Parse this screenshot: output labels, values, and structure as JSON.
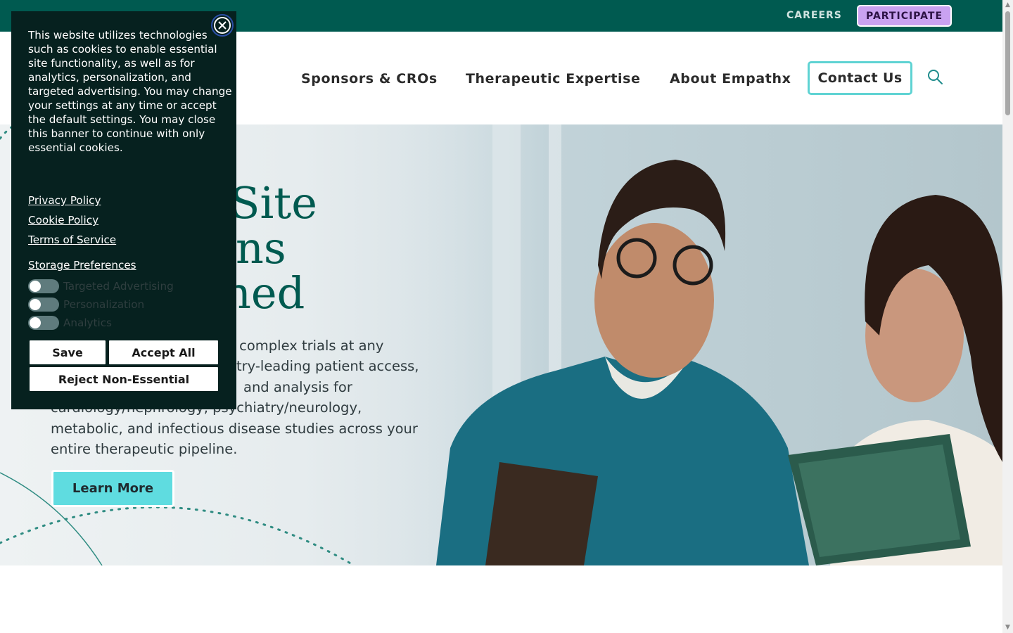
{
  "topbar": {
    "careers_label": "CAREERS",
    "participate_label": "PARTICIPATE"
  },
  "nav": {
    "items": [
      {
        "label": "Sponsors & CROs"
      },
      {
        "label": "Therapeutic Expertise"
      },
      {
        "label": "About Empathx"
      }
    ],
    "contact_label": "Contact Us",
    "search_icon": "search-icon"
  },
  "hero": {
    "title_line1": "Site",
    "title_line2": "ns",
    "title_line3": "ned",
    "body_line1": "o complex trials at any",
    "body_line2": "try-leading patient access,",
    "body_line3": "and analysis for",
    "body_line4": "cardiology/nephrology, psychiatry/neurology,",
    "body_line5": "metabolic, and infectious disease studies across your",
    "body_line6": "entire therapeutic pipeline.",
    "learn_more_label": "Learn More"
  },
  "cookie_banner": {
    "text": "This website utilizes technologies such as cookies to enable essential site functionality, as well as for analytics, personalization, and targeted advertising. You may change your settings at any time or accept the default settings. You may close this banner to continue with only essential cookies.",
    "links": {
      "privacy": "Privacy Policy",
      "cookie": "Cookie Policy",
      "terms": "Terms of Service",
      "storage": "Storage Preferences"
    },
    "toggles": [
      {
        "label": "Targeted Advertising",
        "on": false
      },
      {
        "label": "Personalization",
        "on": false
      },
      {
        "label": "Analytics",
        "on": false
      }
    ],
    "buttons": {
      "save": "Save",
      "accept_all": "Accept All",
      "reject": "Reject Non-Essential"
    },
    "close_icon": "close-icon"
  },
  "colors": {
    "brand_teal": "#005a50",
    "accent_cyan": "#5fdce0",
    "participate_purple": "#c9a2f1",
    "banner_bg": "#06211f"
  }
}
